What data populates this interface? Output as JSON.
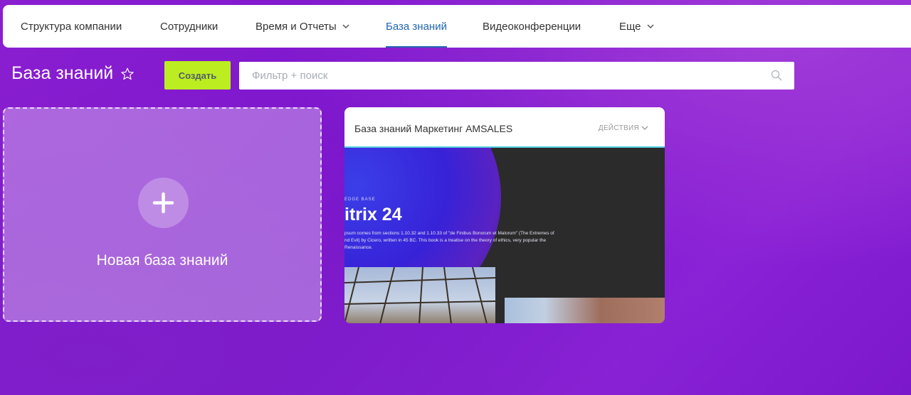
{
  "nav": {
    "tabs": [
      {
        "label": "Структура компании"
      },
      {
        "label": "Сотрудники"
      },
      {
        "label": "Время и Отчеты"
      },
      {
        "label": "База знаний"
      },
      {
        "label": "Видеоконференции"
      },
      {
        "label": "Еще"
      }
    ],
    "active_tab": "База знаний"
  },
  "page": {
    "title": "База знаний"
  },
  "toolbar": {
    "create_label": "Создать"
  },
  "search": {
    "placeholder": "Фильтр + поиск",
    "value": ""
  },
  "new_card": {
    "label": "Новая база знаний"
  },
  "kb_card": {
    "title": "База знаний Маркетинг AMSALES",
    "actions_label": "ДЕЙСТВИЯ",
    "preview": {
      "kicker": "EDGE BASE",
      "brand": "itrix 24",
      "description": "psum comes from sections 1.10.32 and 1.10.33 of \"de Finibus Bonorum et Malorum\" (The Extremes of nd Evil) by Cicero, written in 45 BC. This book is a treatise on the theory of ethics, very popular the Renaissance."
    }
  },
  "colors": {
    "accent_blue": "#2067b0",
    "create_green": "#bbed21",
    "background_purple": "#7a14cc"
  }
}
